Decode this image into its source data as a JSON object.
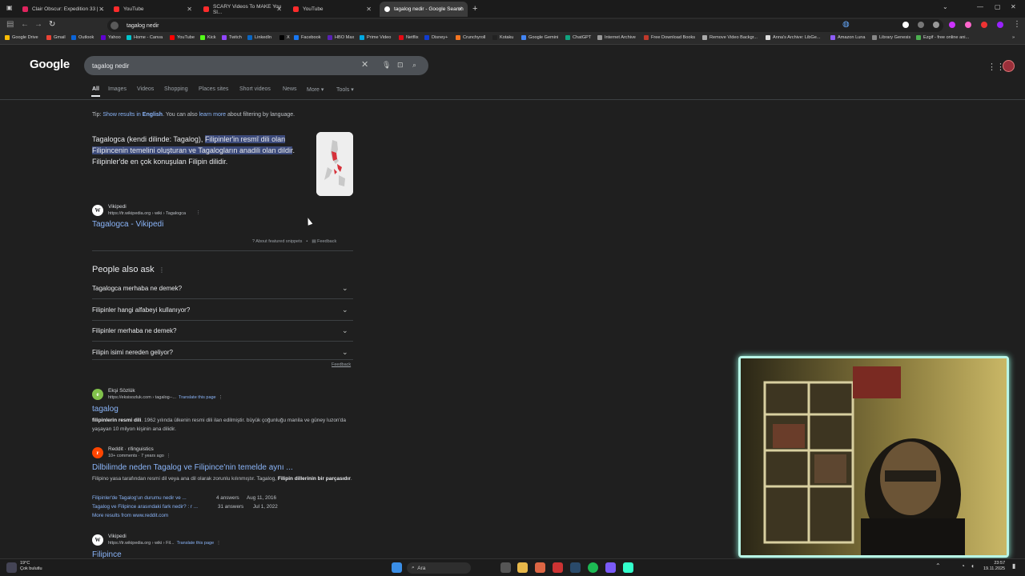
{
  "browser": {
    "tabs": [
      {
        "label": "Clair Obscur: Expedition 33 | ...",
        "icon": "kick-icon"
      },
      {
        "label": "YouTube",
        "icon": "youtube-icon"
      },
      {
        "label": "SCARY Videos To MAKE You Sl...",
        "icon": "youtube-icon"
      },
      {
        "label": "YouTube",
        "icon": "youtube-icon"
      },
      {
        "label": "tagalog nedir - Google Search",
        "icon": "google-icon",
        "active": true
      }
    ],
    "address": "tagalog nedir",
    "bookmarks": [
      "Google Drive",
      "Gmail",
      "Outlook",
      "Yahoo",
      "Home - Canva",
      "YouTube",
      "Kick",
      "Twitch",
      "LinkedIn",
      "X",
      "Facebook",
      "HBO Max",
      "Prime Video",
      "Netflix",
      "Disney+",
      "Crunchyroll",
      "Kotaku",
      "Google Gemini",
      "ChatGPT",
      "Internet Archive",
      "Free Download Books",
      "Remove Video Backgr...",
      "Anna's Archive: LibGe...",
      "Amazon Luna",
      "Library Genesis",
      "Ezgif - free online ani..."
    ]
  },
  "google": {
    "logo": "Google",
    "query": "tagalog nedir",
    "nav": [
      "All",
      "Images",
      "Videos",
      "Shopping",
      "Places sites",
      "Short videos",
      "News",
      "More",
      "Tools"
    ],
    "tip": {
      "prefix": "Tip: ",
      "link1": "Show results in",
      "lang": "English",
      "mid": ". You can also ",
      "link2": "learn more",
      "suffix": " about filtering by language."
    },
    "featured": {
      "lead": "Tagalogca (kendi dilinde: Tagalog), ",
      "highlight": "Filipinler'in resmî dili olan Filipincenin temelini oluşturan ve Tagalogların anadili olan dildir",
      "tail": ". Filipinler'de en çok konuşulan Filipin dilidir.",
      "source_name": "Vikipedi",
      "source_url": "https://tr.wikipedia.org › wiki › Tagalogca",
      "title": "Tagalogca - Vikipedi",
      "about": "About featured snippets",
      "feedback": "Feedback"
    },
    "paa": {
      "title": "People also ask",
      "questions": [
        "Tagalogca merhaba ne demek?",
        "Filipinler hangi alfabeyi kullanıyor?",
        "Filipinler merhaba ne demek?",
        "Filipin isimi nereden geliyor?"
      ],
      "feedback": "Feedback"
    },
    "results": [
      {
        "source": "Ekşi Sözlük",
        "url": "https://eksisozluk.com › tagalog--...",
        "translate": "Translate this page",
        "title": "tagalog",
        "snippet_bold": "filipinlerin resmi dili",
        "snippet": ". 1962 yılında ülkenin resmi dili ilan edilmiştir. büyük çoğunluğu manila ve güney luzon'da yaşayan 10 milyon kişinin ana dilidir."
      },
      {
        "source": "Reddit · r/linguistics",
        "url": "10+ comments · 7 years ago",
        "title": "Dilbilimde neden Tagalog ve Filipince'nin temelde aynı ...",
        "snippet": "Filipino yasa tarafından resmi dil veya ana dil olarak zorunlu kılınmıştır. Tagalog, ",
        "snippet_bold": "Filipin dillerinin bir parçasıdır",
        "snippet_end": ".",
        "sub": [
          {
            "text": "Filipinler'de Tagalog'un durumu nedir ve ...",
            "answers": "4 answers",
            "date": "Aug 11, 2016"
          },
          {
            "text": "Tagalog ve Filipince arasındaki fark nedir? : r ...",
            "answers": "31 answers",
            "date": "Jul 1, 2022"
          }
        ],
        "more": "More results from www.reddit.com"
      },
      {
        "source": "Vikipedi",
        "url": "https://tr.wikipedia.org › wiki › Fil...",
        "translate": "Translate this page",
        "title": "Filipince"
      }
    ]
  },
  "taskbar": {
    "weather_temp": "19°C",
    "weather_desc": "Çok bulutlu",
    "search": "Ara",
    "time": "23:57",
    "date": "19.11.2025"
  }
}
